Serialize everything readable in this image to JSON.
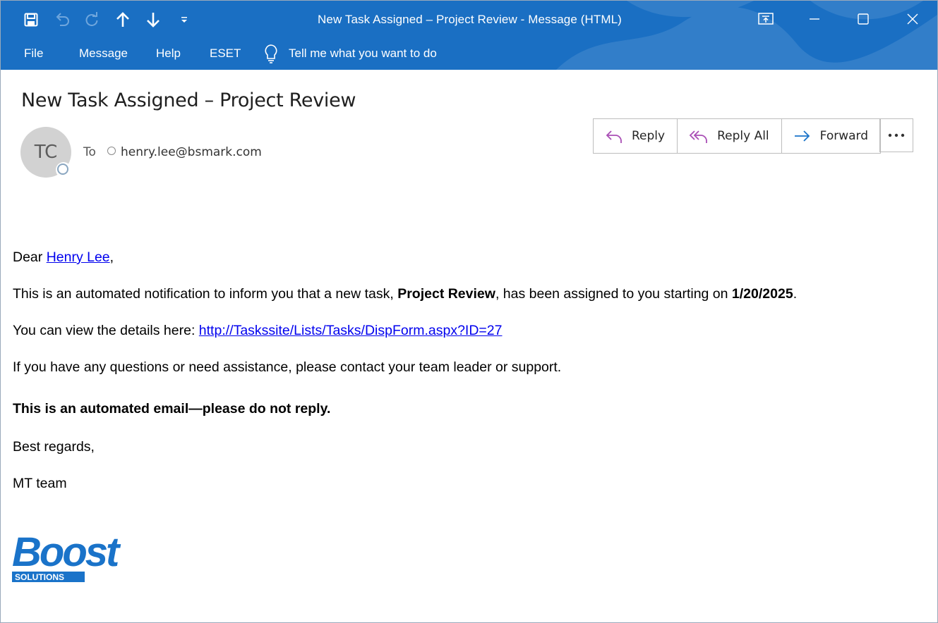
{
  "window": {
    "title": "New Task Assigned – Project Review  -  Message (HTML)",
    "accent_color": "#1a6fc3"
  },
  "quick_access": {
    "icons": [
      "save-icon",
      "undo-icon",
      "redo-icon",
      "previous-item-icon",
      "next-item-icon",
      "customize-toolbar-icon"
    ]
  },
  "window_controls": [
    "restore-ribbon-icon",
    "minimize-icon",
    "maximize-icon",
    "close-icon"
  ],
  "menu": {
    "items": [
      "File",
      "Message",
      "Help",
      "ESET"
    ],
    "tell_me": "Tell me what you want to do"
  },
  "message": {
    "subject": "New Task Assigned – Project Review",
    "sender_initials": "TC",
    "to_label": "To",
    "to_address": "henry.lee@bsmark.com",
    "actions": {
      "reply": "Reply",
      "reply_all": "Reply All",
      "forward": "Forward"
    }
  },
  "body": {
    "greeting_prefix": "Dear ",
    "recipient_name": "Henry Lee",
    "greeting_suffix": ",",
    "notice_prefix": "This is an automated notification to inform you that a new task, ",
    "task_name": "Project Review",
    "notice_middle": ", has been assigned to you starting on ",
    "start_date": "1/20/2025",
    "notice_suffix": ".",
    "details_prefix": "You can view the details here: ",
    "details_link": "http://Taskssite/Lists/Tasks/DispForm.aspx?ID=27",
    "questions": "If you have any questions or need assistance, please contact your team leader or support.",
    "no_reply": "This is an automated email—please do not reply.",
    "closing": "Best regards,",
    "signature": "MT team"
  },
  "logo": {
    "wordmark": "Boost",
    "tagline": "SOLUTIONS",
    "color": "#1a73c9"
  }
}
